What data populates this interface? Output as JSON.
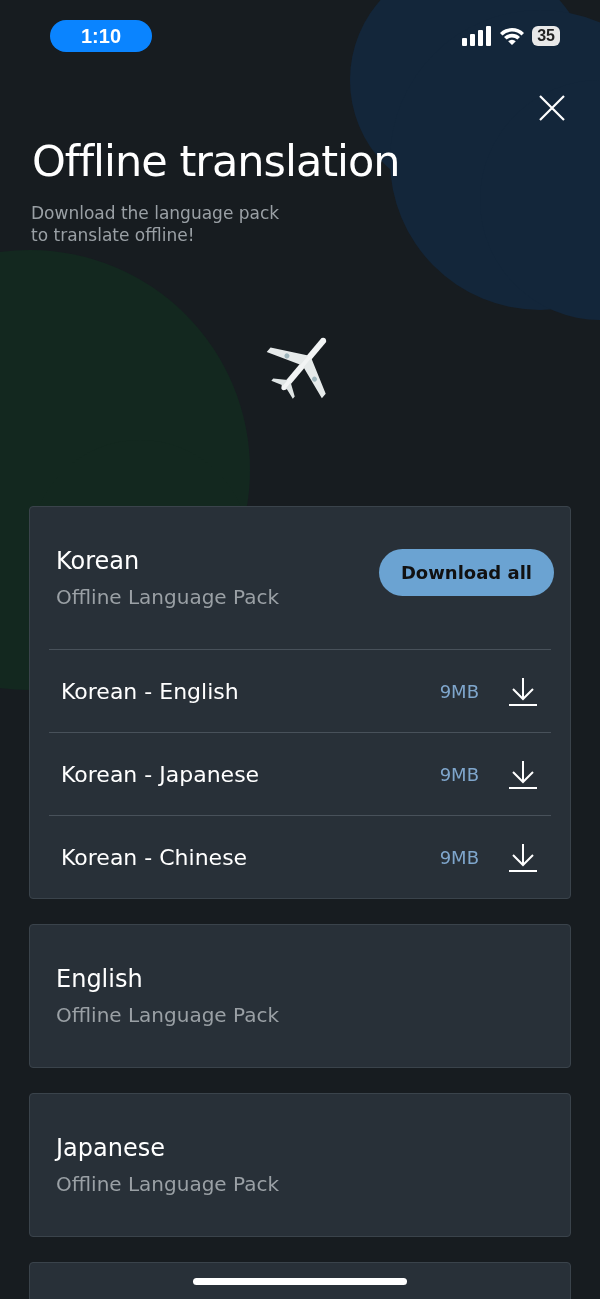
{
  "status_bar": {
    "time": "1:10",
    "battery": "35"
  },
  "header": {
    "title": "Offline translation",
    "subtitle": "Download the language pack\nto translate offline!"
  },
  "packs": [
    {
      "name": "Korean",
      "subtitle": "Offline Language Pack",
      "action": "Download all",
      "pairs": [
        {
          "label": "Korean - English",
          "size": "9MB"
        },
        {
          "label": "Korean - Japanese",
          "size": "9MB"
        },
        {
          "label": "Korean - Chinese",
          "size": "9MB"
        }
      ]
    },
    {
      "name": "English",
      "subtitle": "Offline Language Pack"
    },
    {
      "name": "Japanese",
      "subtitle": "Offline Language Pack"
    }
  ]
}
